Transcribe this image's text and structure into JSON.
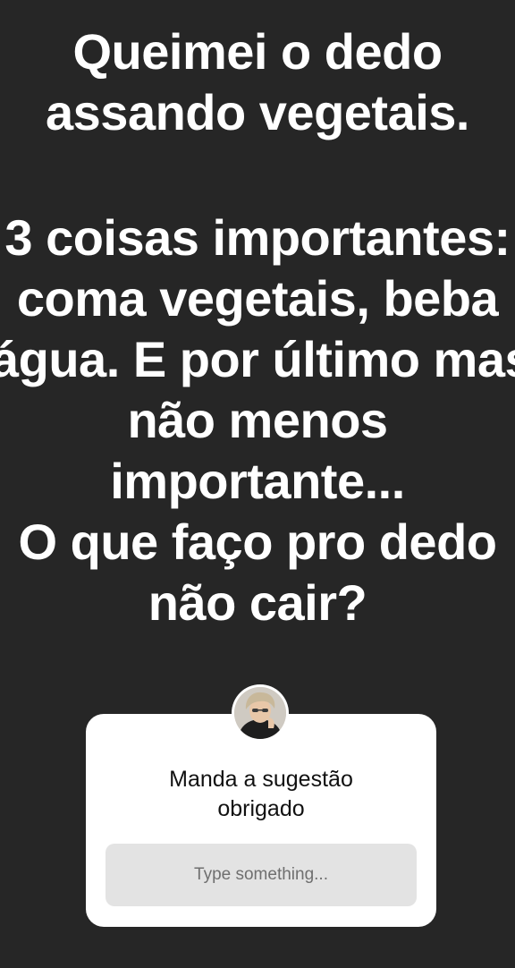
{
  "story": {
    "lines": [
      "Queimei o dedo",
      "assando vegetais.",
      "",
      "3 coisas importantes:",
      "coma vegetais, beba",
      "água. E por último mas",
      "não menos",
      "importante...",
      "O que faço pro dedo",
      "não cair?"
    ]
  },
  "question_sticker": {
    "prompt_line1": "Manda a sugestão",
    "prompt_line2": "obrigado",
    "placeholder": "Type something..."
  },
  "colors": {
    "background": "#262626",
    "text": "#ffffff",
    "card": "#ffffff",
    "field": "#e3e3e3"
  }
}
